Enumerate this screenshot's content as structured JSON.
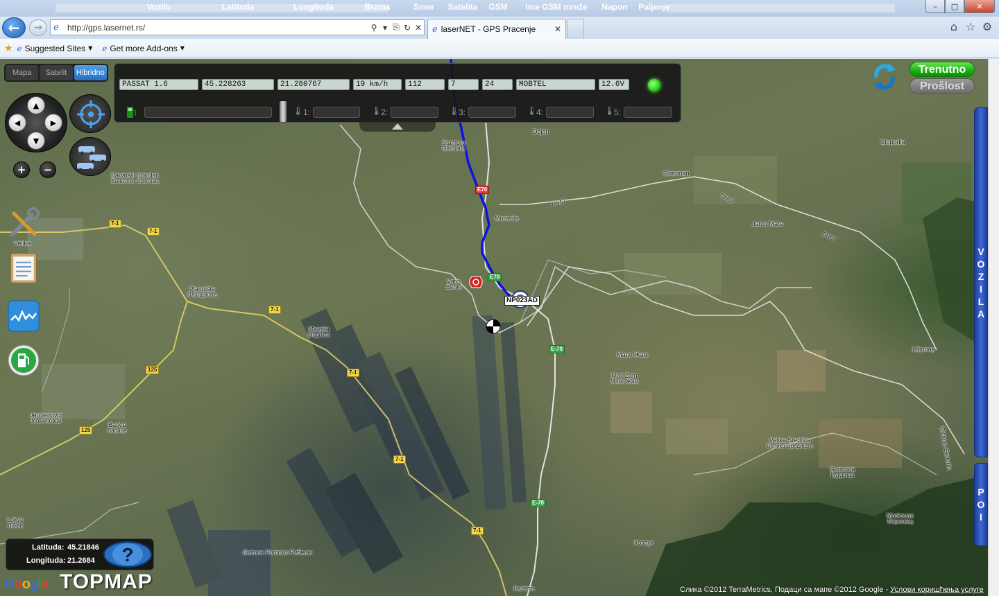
{
  "browser": {
    "address": "http://gps.lasernet.rs/",
    "tab_title": "laserNET - GPS Pracenje",
    "favorites": [
      {
        "label": "Suggested Sites"
      },
      {
        "label": "Get more Add-ons"
      }
    ],
    "window_controls": {
      "minimize": "–",
      "maximize": "□",
      "close": "✕"
    }
  },
  "map_type": {
    "options": [
      "Mapa",
      "Satelit",
      "Hibridno"
    ],
    "selected": "Hibridno"
  },
  "vehicle_panel": {
    "headers": {
      "vehicle": "Vozilo",
      "latitude": "Latituda",
      "longitude": "Longituda",
      "speed": "Brzina",
      "heading": "Smer",
      "satellites": "Satelita",
      "gsm": "GSM",
      "network": "Ime GSM mreže",
      "voltage": "Napon",
      "ignition": "Paljenje"
    },
    "values": {
      "vehicle": "PASSAT 1.6",
      "latitude": "45.228263",
      "longitude": "21.280767",
      "speed": "19 km/h",
      "heading": "112",
      "satellites": "7",
      "gsm": "24",
      "network": "MOBTEL",
      "voltage": "12.6V",
      "ignition_on": true
    },
    "sensors": [
      "1:",
      "2:",
      "3:",
      "4:",
      "5:"
    ]
  },
  "mode": {
    "current": "Trenutno",
    "past": "Prošlost",
    "active": "Trenutno"
  },
  "side_tabs": {
    "vehicles": [
      "V",
      "O",
      "Z",
      "I",
      "L",
      "A"
    ],
    "poi": [
      "P",
      "O",
      "I"
    ]
  },
  "left_tools": {
    "tools_label": "Velika"
  },
  "vehicle_marker": {
    "label": "NP023AD"
  },
  "cursor_coords": {
    "lat_label": "Latituda:",
    "lat_value": "45.21846",
    "lon_label": "Longituda:",
    "lon_value": "21.2684"
  },
  "branding": {
    "google": "Google",
    "topmap": "TOPMAP"
  },
  "copyright": {
    "text": "Слика ©2012 TerraMetrics, Подаци са мапе ©2012 Google - ",
    "terms": "Услови коришћења услуге"
  },
  "map_labels": {
    "places": [
      {
        "name": "Dejan",
        "cyr": ""
      },
      {
        "name": "Stamora",
        "cyr": "Germana"
      },
      {
        "name": "Clopodia",
        "cyr": ""
      },
      {
        "name": "Gherman",
        "cyr": ""
      },
      {
        "name": "Moravița",
        "cyr": ""
      },
      {
        "name": "Jamu Mare",
        "cyr": ""
      },
      {
        "name": "Banatski Sokolac",
        "cyr": "Банатски Соколац"
      },
      {
        "name": "Plandište",
        "cyr": "Пландиште"
      },
      {
        "name": "Vatin",
        "cyr": "Ватин"
      },
      {
        "name": "Margita",
        "cyr": "Маргита"
      },
      {
        "name": "Мали Жам",
        "cyr": ""
      },
      {
        "name": "Mali Zam",
        "cyr": "Мали Жам"
      },
      {
        "name": "Lățunaș",
        "cyr": ""
      },
      {
        "name": "Jermenovci",
        "cyr": "Јерменовци"
      },
      {
        "name": "Barice",
        "cyr": "Барице"
      },
      {
        "name": "Velike Središte",
        "cyr": "Велико Средиште"
      },
      {
        "name": "Gudurica",
        "cyr": "Гудурица"
      },
      {
        "name": "Markovac",
        "cyr": "Марковац"
      },
      {
        "name": "Lokve",
        "cyr": "Локве"
      },
      {
        "name": "Великн Ритски Рибњак",
        "cyr": ""
      },
      {
        "name": "Козлук",
        "cyr": ""
      },
      {
        "name": "Балата",
        "cyr": ""
      },
      {
        "name": "Ciclova Severin",
        "cyr": ""
      }
    ],
    "roads": [
      "7-1",
      "125",
      "E-70",
      "DN57",
      "DN57",
      "E70",
      "DN57"
    ]
  }
}
